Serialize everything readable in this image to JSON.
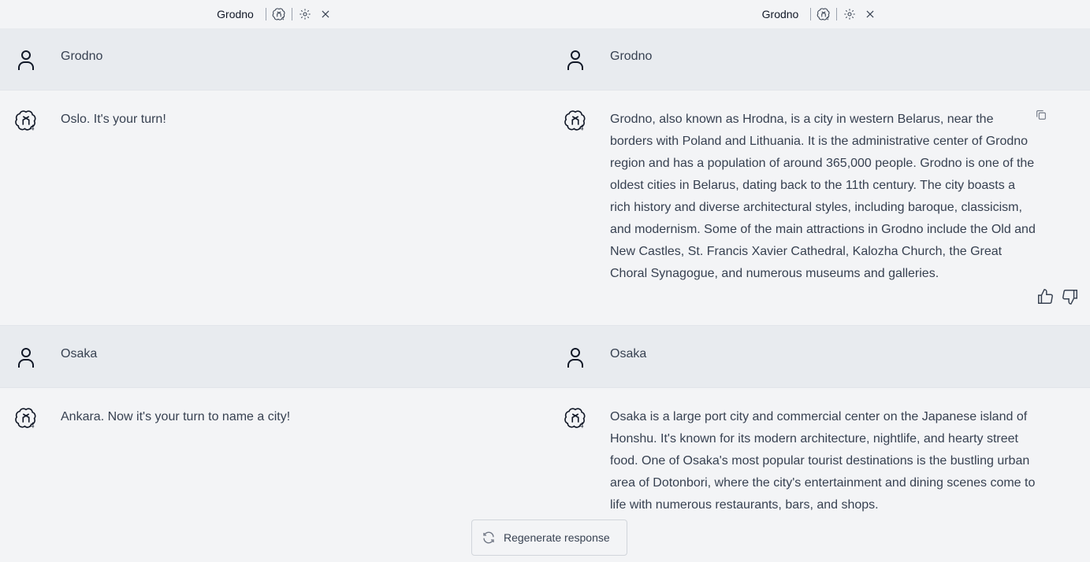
{
  "panes": [
    {
      "header": {
        "model_name": "Grodno"
      },
      "messages": [
        {
          "role": "user",
          "text": "Grodno"
        },
        {
          "role": "assistant",
          "text": "Oslo. It's your turn!"
        },
        {
          "role": "user",
          "text": "Osaka"
        },
        {
          "role": "assistant",
          "text": "Ankara. Now it's your turn to name a city!"
        }
      ]
    },
    {
      "header": {
        "model_name": "Grodno"
      },
      "messages": [
        {
          "role": "user",
          "text": "Grodno"
        },
        {
          "role": "assistant",
          "text": "Grodno, also known as Hrodna, is a city in western Belarus, near the borders with Poland and Lithuania. It is the administrative center of Grodno region and has a population of around 365,000 people. Grodno is one of the oldest cities in Belarus, dating back to the 11th century. The city boasts a rich history and diverse architectural styles, including baroque, classicism, and modernism. Some of the main attractions in Grodno include the Old and New Castles, St. Francis Xavier Cathedral, Kalozha Church, the Great Choral Synagogue, and numerous museums and galleries."
        },
        {
          "role": "user",
          "text": "Osaka"
        },
        {
          "role": "assistant",
          "text": "Osaka is a large port city and commercial center on the Japanese island of Honshu. It's known for its modern architecture, nightlife, and hearty street food. One of Osaka's most popular tourist destinations is the bustling urban area of Dotonbori, where the city's entertainment and dining scenes come to life with numerous restaurants, bars, and shops."
        }
      ]
    }
  ],
  "regenerate": {
    "label": "Regenerate response"
  },
  "icons": {
    "model": "openai-gpt4-icon",
    "settings": "gear-icon",
    "close": "close-icon",
    "user": "user-icon",
    "copy": "copy-icon",
    "thumbs_up": "thumbs-up-icon",
    "thumbs_down": "thumbs-down-icon",
    "regenerate": "refresh-icon"
  }
}
